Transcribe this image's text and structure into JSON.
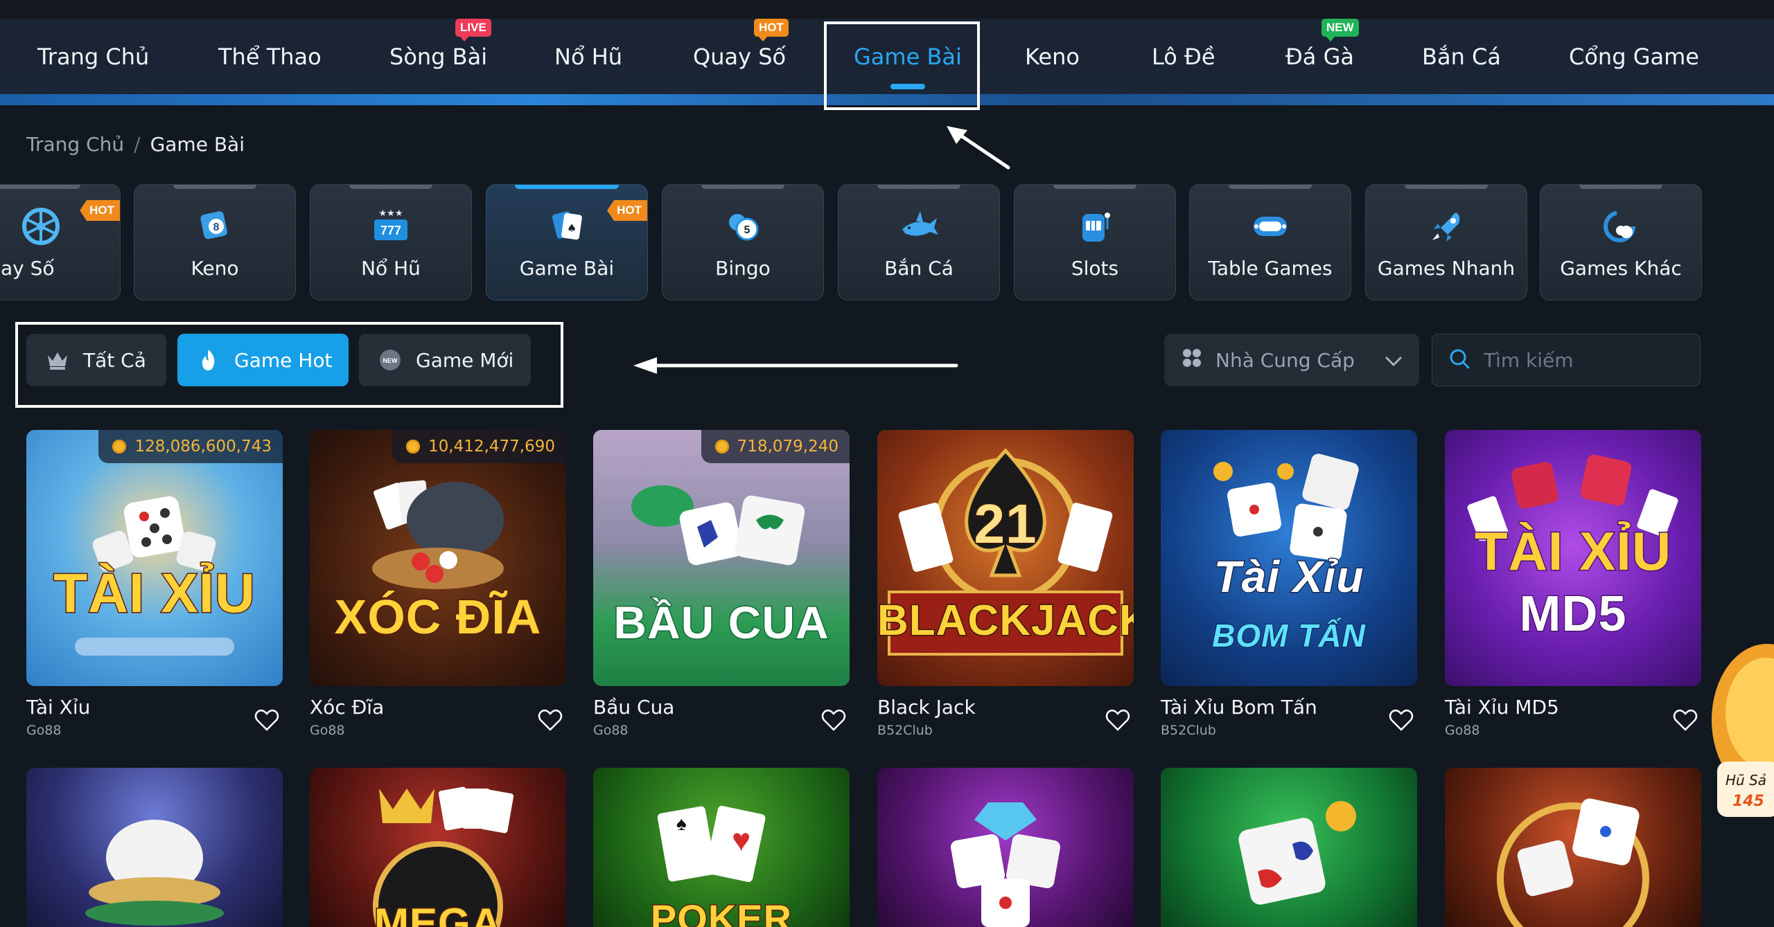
{
  "nav": {
    "items": [
      {
        "label": "Trang Chủ"
      },
      {
        "label": "Thể Thao"
      },
      {
        "label": "Sòng Bài",
        "badge": "LIVE"
      },
      {
        "label": "Nổ Hũ"
      },
      {
        "label": "Quay Số",
        "badge": "HOT"
      },
      {
        "label": "Game Bài",
        "active": true
      },
      {
        "label": "Keno"
      },
      {
        "label": "Lô Đề"
      },
      {
        "label": "Đá Gà",
        "badge": "NEW"
      },
      {
        "label": "Bắn Cá"
      },
      {
        "label": "Cổng Game"
      }
    ]
  },
  "breadcrumb": {
    "home": "Trang Chủ",
    "separator": "/",
    "current": "Game Bài"
  },
  "categories": [
    {
      "label": "ay Số",
      "icon": "wheel-icon",
      "badge": "HOT"
    },
    {
      "label": "Keno",
      "icon": "keno-ball-icon"
    },
    {
      "label": "Nổ Hũ",
      "icon": "slot-777-icon"
    },
    {
      "label": "Game Bài",
      "icon": "cards-icon",
      "badge": "HOT",
      "active": true
    },
    {
      "label": "Bingo",
      "icon": "bingo-ball-icon"
    },
    {
      "label": "Bắn Cá",
      "icon": "shark-icon"
    },
    {
      "label": "Slots",
      "icon": "slot-machine-icon"
    },
    {
      "label": "Table Games",
      "icon": "table-icon"
    },
    {
      "label": "Games Nhanh",
      "icon": "rocket-icon"
    },
    {
      "label": "Games Khác",
      "icon": "more-games-icon"
    }
  ],
  "filters": {
    "all": "Tất Cả",
    "hot": "Game Hot",
    "new": "Game Mới",
    "new_icon_text": "NEW"
  },
  "provider": {
    "label": "Nhà Cung Cấp"
  },
  "search": {
    "placeholder": "Tìm kiếm"
  },
  "games": [
    {
      "name": "Tài Xỉu",
      "provider": "Go88",
      "jackpot": "128,086,600,743",
      "thumb_text": "TÀI XỈU"
    },
    {
      "name": "Xóc Đĩa",
      "provider": "Go88",
      "jackpot": "10,412,477,690",
      "thumb_text": "XÓC ĐĨA"
    },
    {
      "name": "Bầu Cua",
      "provider": "Go88",
      "jackpot": "718,079,240",
      "thumb_text": "BẦU CUA"
    },
    {
      "name": "Black Jack",
      "provider": "B52Club",
      "thumb_text": "BLACKJACK",
      "thumb_number": "21"
    },
    {
      "name": "Tài Xỉu Bom Tấn",
      "provider": "B52Club",
      "thumb_text": "Tài Xỉu",
      "thumb_subtext": "BOM TẤN"
    },
    {
      "name": "Tài Xỉu MD5",
      "provider": "Go88",
      "thumb_text": "TÀI XỈU",
      "thumb_subtext": "MD5"
    }
  ],
  "games_row2": [
    {
      "thumb": "bowl"
    },
    {
      "thumb": "mega",
      "thumb_text": "MEGA"
    },
    {
      "thumb": "poker",
      "thumb_text": "POKER"
    },
    {
      "thumb": "dice-gems"
    },
    {
      "thumb": "crab-dice"
    },
    {
      "thumb": "dice-ring"
    }
  ],
  "side_promo": {
    "line1": "Hũ Sả",
    "line2": "145"
  },
  "colors": {
    "accent": "#2aa7f5",
    "hot": "#f08a1c",
    "live": "#ee3b58",
    "new": "#21b35a",
    "jackpot": "#f5b53a"
  }
}
